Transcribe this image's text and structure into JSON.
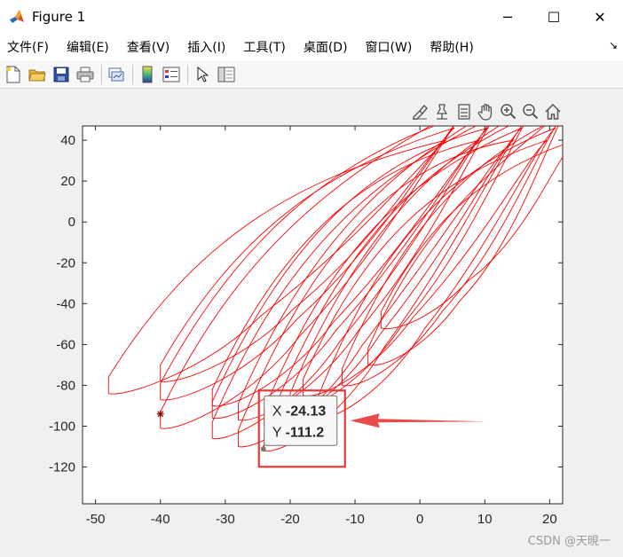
{
  "window": {
    "title": "Figure 1",
    "icon": "matlab-logo-icon",
    "controls": {
      "minimize": "─",
      "maximize": "☐",
      "close": "✕"
    }
  },
  "menu": {
    "items": [
      "文件(F)",
      "编辑(E)",
      "查看(V)",
      "插入(I)",
      "工具(T)",
      "桌面(D)",
      "窗口(W)",
      "帮助(H)"
    ],
    "overflow": "↘"
  },
  "toolbar": {
    "icons": [
      "new-figure-icon",
      "open-folder-icon",
      "save-icon",
      "print-icon",
      "link-plot-icon",
      "colorbar-icon",
      "legend-icon",
      "pointer-icon",
      "property-editor-icon"
    ]
  },
  "axes_toolbar": {
    "icons": [
      "brush-icon",
      "data-tip-icon",
      "pan-hand-icon",
      "zoom-in-icon",
      "zoom-out-icon",
      "home-icon",
      "export-icon"
    ]
  },
  "colors": {
    "line": "#ff0000",
    "datatip_border": "#6f6f6f",
    "highlight_box": "#e53935",
    "arrow": "#ea4a4a",
    "marker": "#8b0000"
  },
  "chart_data": {
    "type": "line",
    "title": "",
    "xlabel": "",
    "ylabel": "",
    "xlim": [
      -52,
      22
    ],
    "ylim": [
      -138,
      47
    ],
    "xticks": [
      -50,
      -40,
      -30,
      -20,
      -10,
      0,
      10,
      20
    ],
    "yticks": [
      40,
      20,
      0,
      -20,
      -40,
      -60,
      -80,
      -100,
      -120
    ],
    "grid": false,
    "marker": {
      "x": -40,
      "y": -94,
      "symbol": "*"
    },
    "loops": [
      {
        "x_min": -48,
        "y_min": -84
      },
      {
        "x_min": -40,
        "y_min": -78
      },
      {
        "x_min": -40,
        "y_min": -87
      },
      {
        "x_min": -40,
        "y_min": -101
      },
      {
        "x_min": -32,
        "y_min": -90
      },
      {
        "x_min": -32,
        "y_min": -96
      },
      {
        "x_min": -32,
        "y_min": -106
      },
      {
        "x_min": -28,
        "y_min": -97
      },
      {
        "x_min": -28,
        "y_min": -110
      },
      {
        "x_min": -24,
        "y_min": -100
      },
      {
        "x_min": -24,
        "y_min": -112
      },
      {
        "x_min": -20,
        "y_min": -92
      },
      {
        "x_min": -18,
        "y_min": -85
      },
      {
        "x_min": -16,
        "y_min": -96
      },
      {
        "x_min": -12,
        "y_min": -80
      },
      {
        "x_min": -8,
        "y_min": -70
      },
      {
        "x_min": -6,
        "y_min": -52
      }
    ],
    "datatip": {
      "x_label": "X",
      "x_value": "-24.13",
      "y_label": "Y",
      "y_value": "-111.2",
      "x": -24.13,
      "y": -111.2
    }
  },
  "watermark": "CSDN @天晛一"
}
